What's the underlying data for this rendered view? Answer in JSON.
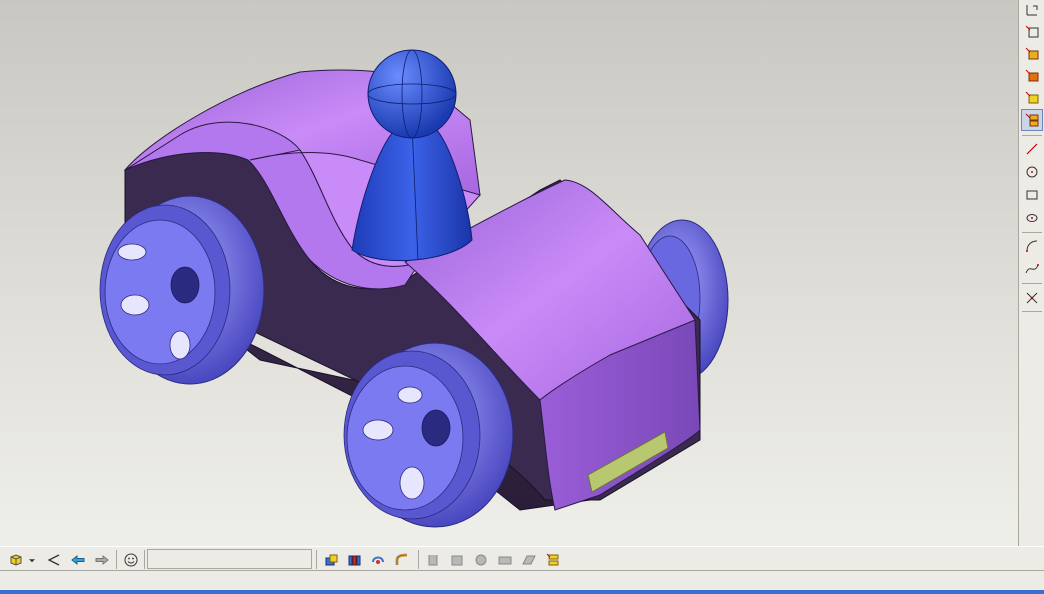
{
  "viewport": {
    "model": "toy-car",
    "colors": {
      "body": "#b070e8",
      "body_shadow": "#3a2a4a",
      "wheel": "#7a78e8",
      "figure": "#2a4fd0",
      "bumper_plate": "#b8c870",
      "background_top": "#c9c7c2",
      "background_bottom": "#efefe9"
    }
  },
  "right_toolbar": {
    "items": [
      {
        "name": "datum-plane-icon"
      },
      {
        "name": "datum-csys-icon"
      },
      {
        "name": "extrude-icon"
      },
      {
        "name": "revolve-icon"
      },
      {
        "name": "sweep-icon"
      },
      {
        "name": "blend-icon"
      },
      {
        "name": "line-icon"
      },
      {
        "name": "circle-icon"
      },
      {
        "name": "rectangle-icon"
      },
      {
        "name": "ellipse-icon"
      },
      {
        "name": "arc-icon"
      },
      {
        "name": "spline-icon"
      },
      {
        "name": "trim-icon"
      }
    ]
  },
  "bottom_toolbar": {
    "status_text": "",
    "items": [
      {
        "name": "view-cube-icon"
      },
      {
        "name": "dropdown-arrow-icon"
      },
      {
        "name": "select-arrow-icon"
      },
      {
        "name": "back-arrow-icon"
      },
      {
        "name": "forward-arrow-icon"
      },
      {
        "name": "smiley-icon"
      },
      {
        "name": "feature-a-icon"
      },
      {
        "name": "feature-b-icon"
      },
      {
        "name": "feature-c-icon"
      },
      {
        "name": "feature-d-icon"
      },
      {
        "name": "gray-tool-1-icon"
      },
      {
        "name": "gray-tool-2-icon"
      },
      {
        "name": "gray-tool-3-icon"
      },
      {
        "name": "gray-tool-4-icon"
      },
      {
        "name": "gray-tool-5-icon"
      },
      {
        "name": "layers-icon"
      }
    ]
  }
}
